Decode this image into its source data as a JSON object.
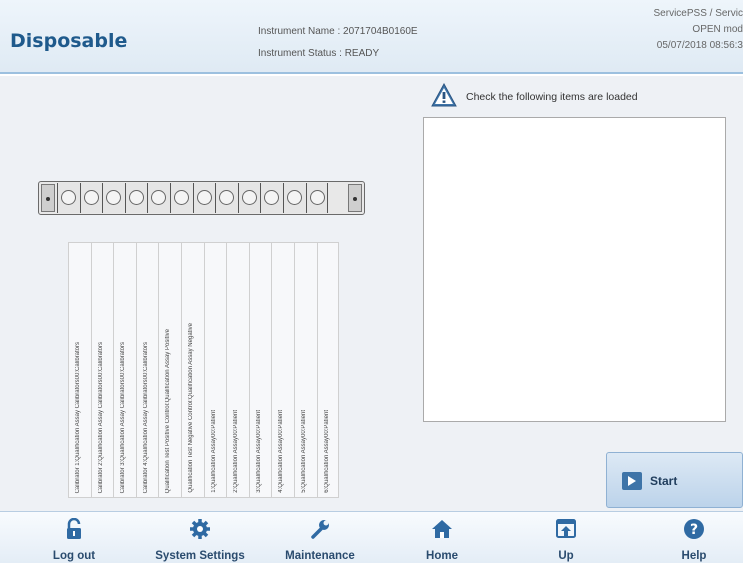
{
  "header": {
    "title": "Disposable",
    "instrument_name_label": "Instrument Name : 2071704B0160E",
    "instrument_status_label": "Instrument Status : READY",
    "user": "ServicePSS / Servic",
    "mode": "OPEN mod",
    "datetime": "05/07/2018 08:56:3"
  },
  "rack": {
    "slot_labels": [
      "Calibrator 1:Qualification Assay Calibrators00:Calibrators",
      "Calibrator 2:Qualification Assay Calibrators00:Calibrators",
      "Calibrator 3:Qualification Assay Calibrators00:Calibrators",
      "Calibrator 4:Qualification Assay Calibrators00:Calibrators",
      "Qualification Test Positive Control:Qualification Assay Positive",
      "Qualification Test Negative Control:Qualification Assay Negative",
      "1:Qualification Assay00:Patient",
      "2:Qualification Assay00:Patient",
      "3:Qualification Assay00:Patient",
      "4:Qualification Assay00:Patient",
      "5:Qualification Assay00:Patient",
      "6:Qualification Assay00:Patient"
    ]
  },
  "check": {
    "message": "Check the following items are loaded",
    "items": []
  },
  "start_label": "Start",
  "footer": {
    "logout": "Log out",
    "settings": "System Settings",
    "maintenance": "Maintenance",
    "home": "Home",
    "up": "Up",
    "help": "Help"
  },
  "colors": {
    "accent": "#1f5a8c",
    "start_icon": "#3e74a8",
    "warning": "#3e74a8"
  }
}
